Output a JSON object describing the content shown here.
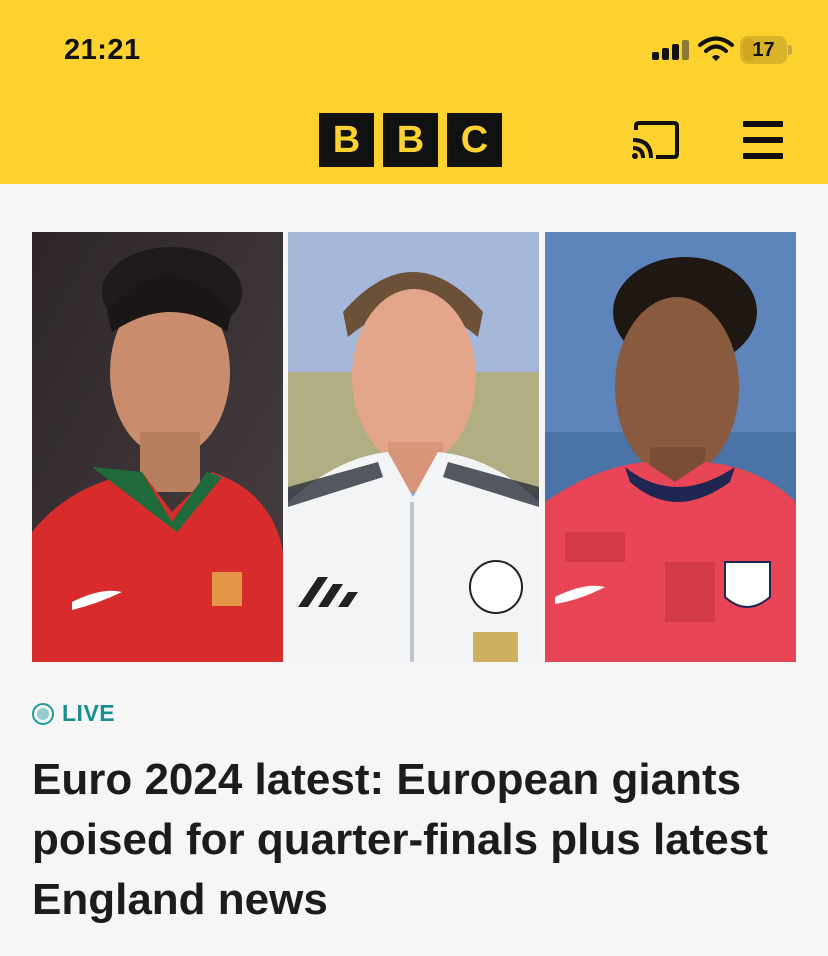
{
  "status_bar": {
    "time": "21:21",
    "battery": "17"
  },
  "header": {
    "logo_letters": [
      "B",
      "B",
      "C"
    ],
    "cast_icon": "cast-icon",
    "menu_icon": "hamburger-menu-icon",
    "brand_color": "#fdd12e"
  },
  "hero": {
    "images": [
      "portugal-player-photo",
      "germany-player-photo",
      "england-player-photo"
    ]
  },
  "article": {
    "badge": "LIVE",
    "headline": "Euro 2024 latest: European giants poised for quarter-finals plus latest England news",
    "accent_color": "#1a8f92"
  }
}
